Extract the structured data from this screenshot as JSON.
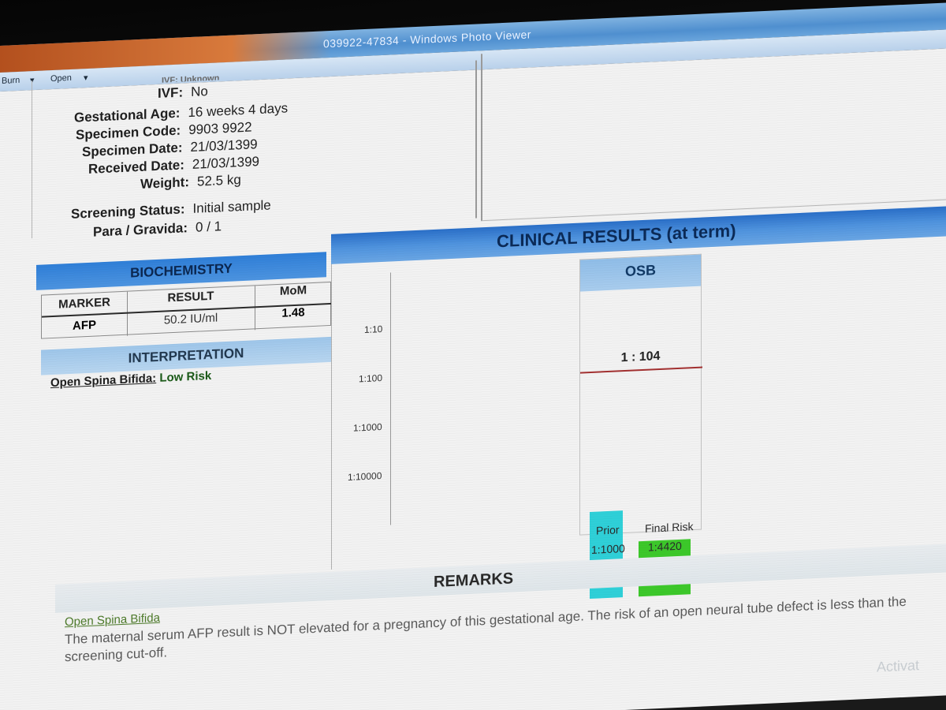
{
  "window": {
    "title": "039922-47834 - Windows Photo Viewer"
  },
  "menu": {
    "items": [
      "Burn",
      "Open"
    ]
  },
  "patient_info": {
    "cut_label": "IVF: Unknown",
    "rows": [
      {
        "label": "IVF:",
        "value": "No"
      },
      {
        "label": "Gestational Age:",
        "value": "16 weeks 4 days"
      },
      {
        "label": "Specimen Code:",
        "value": "9903 9922"
      },
      {
        "label": "Specimen Date:",
        "value": "21/03/1399"
      },
      {
        "label": "Received Date:",
        "value": "21/03/1399"
      },
      {
        "label": "Weight:",
        "value": "52.5 kg"
      },
      {
        "label": "Screening Status:",
        "value": "Initial sample"
      },
      {
        "label": "Para / Gravida:",
        "value": "0 / 1"
      }
    ]
  },
  "biochemistry": {
    "title": "BIOCHEMISTRY",
    "headers": {
      "marker": "MARKER",
      "result": "RESULT",
      "mom": "MoM"
    },
    "row": {
      "marker": "AFP",
      "result": "50.2 IU/ml",
      "mom": "1.48"
    }
  },
  "interpretation": {
    "title": "INTERPRETATION",
    "label": "Open Spina Bifida:",
    "value": "Low Risk"
  },
  "clinical": {
    "title": "CLINICAL RESULTS (at term)",
    "osb_label": "OSB",
    "cutoff_ratio": "1 : 104",
    "colors": {
      "prior": "#2fd0d8",
      "final": "#3cc82a",
      "cutoff": "#a33030"
    }
  },
  "chart_data": {
    "type": "bar",
    "title": "OSB",
    "yscale": "log-reciprocal",
    "yticks": [
      "1:10",
      "1:100",
      "1:1000",
      "1:10000"
    ],
    "categories": [
      "Prior",
      "Final Risk"
    ],
    "value_labels": [
      "1:1000",
      "1:4420"
    ],
    "values": [
      1000,
      4420
    ],
    "cutoff": 104
  },
  "remarks": {
    "title": "REMARKS",
    "subtitle": "Open Spina Bifida",
    "text": "The maternal serum AFP result is NOT elevated for a pregnancy of this gestational age. The risk of an open neural tube defect is less than the screening cut-off."
  },
  "watermark": {
    "text": "Activat"
  }
}
